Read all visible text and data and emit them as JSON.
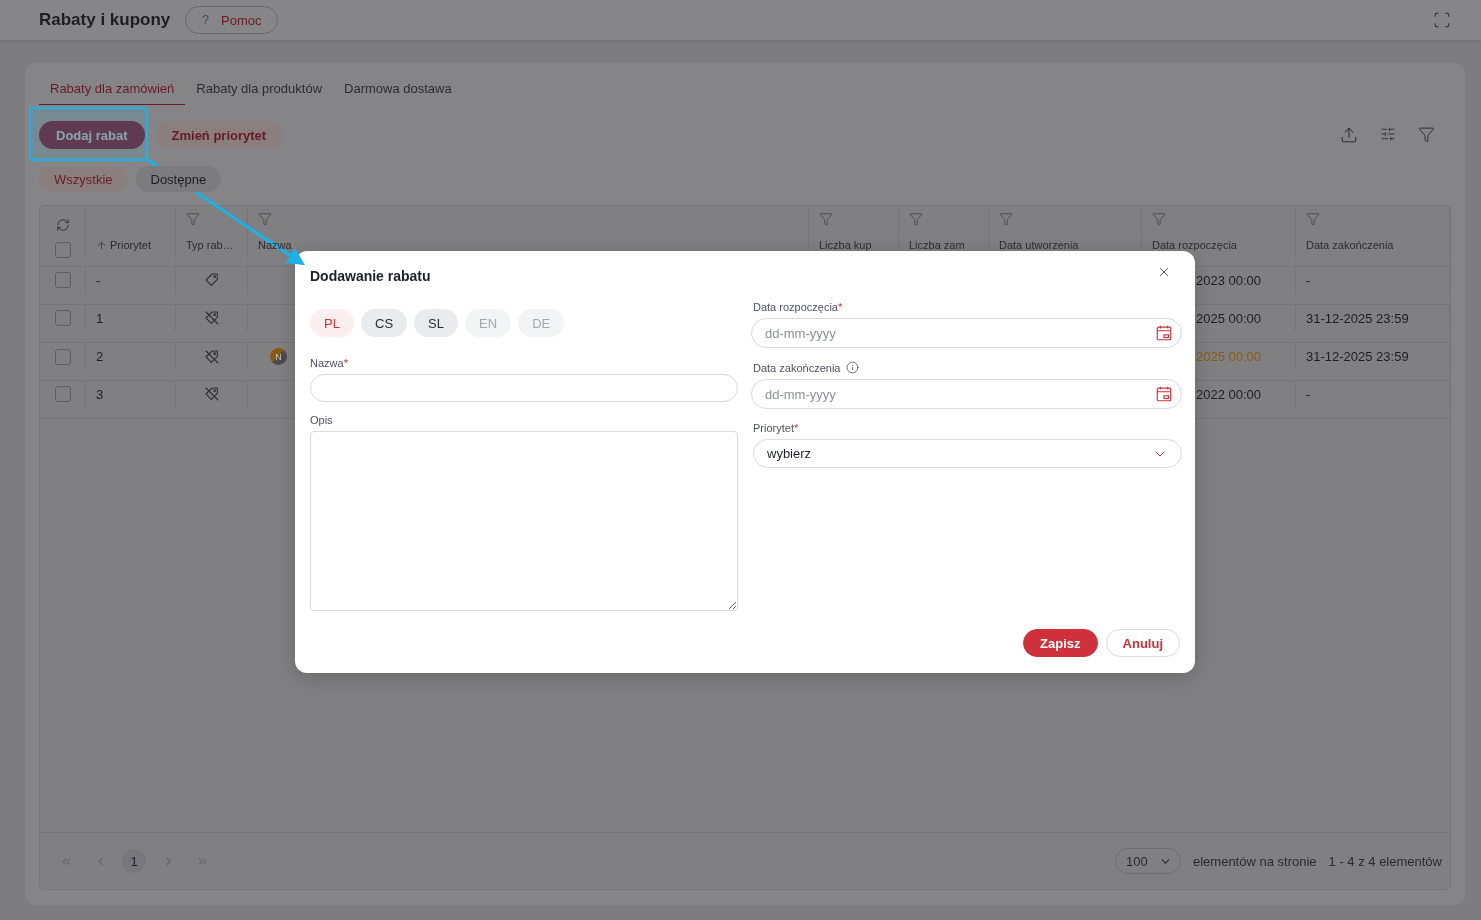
{
  "header": {
    "title": "Rabaty i kupony",
    "help_button": {
      "icon_text": "?",
      "label": "Pomoc"
    }
  },
  "tabs": [
    {
      "label": "Rabaty dla zamówień",
      "selected": true
    },
    {
      "label": "Rabaty dla produktów",
      "selected": false
    },
    {
      "label": "Darmowa dostawa",
      "selected": false
    }
  ],
  "actions": [
    {
      "label": "Dodaj rabat",
      "kind": "primary"
    },
    {
      "label": "Zmień priorytet",
      "kind": "secondary"
    }
  ],
  "filters": [
    {
      "label": "Wszystkie",
      "selected": true
    },
    {
      "label": "Dostępne",
      "selected": false
    }
  ],
  "table": {
    "select_all_checked": false,
    "columns": [
      {
        "label": "Priorytet",
        "kind": "sort"
      },
      {
        "label": "Typ rab…",
        "kind": "filter"
      },
      {
        "label": "Nazwa",
        "kind": "filter"
      },
      {
        "label": "Liczba kup",
        "kind": "filter"
      },
      {
        "label": "Liczba zam",
        "kind": "filter"
      },
      {
        "label": "Data utworzenia",
        "kind": "filter"
      },
      {
        "label": "Data rozpoczęcia",
        "kind": "filter"
      },
      {
        "label": "Data zakończenia",
        "kind": "filter"
      }
    ],
    "rows": [
      {
        "checked": false,
        "priority": "-",
        "kind": "tag",
        "start": "2023 00:00",
        "start_warning": false,
        "end": "-"
      },
      {
        "checked": false,
        "priority": "1",
        "kind": "tag_off",
        "start": "2025 00:00",
        "start_warning": false,
        "end": "31-12-2025 23:59"
      },
      {
        "checked": false,
        "priority": "2",
        "kind": "tag_off",
        "badge": "N",
        "start": "2025 00:00",
        "start_warning": true,
        "end": "31-12-2025 23:59"
      },
      {
        "checked": false,
        "priority": "3",
        "kind": "tag_off",
        "start": "2022 00:00",
        "start_warning": false,
        "end": "-"
      }
    ]
  },
  "pagination": {
    "pages": [
      {
        "label": "1",
        "selected": true
      }
    ],
    "page_size": "100",
    "page_size_label": "elementów na stronie",
    "summary": "1 - 4 z 4 elementów"
  },
  "dialog": {
    "title": "Dodawanie rabatu",
    "languages": [
      {
        "label": "PL",
        "selected": true,
        "disabled": false
      },
      {
        "label": "CS",
        "selected": false,
        "disabled": false
      },
      {
        "label": "SL",
        "selected": false,
        "disabled": false
      },
      {
        "label": "EN",
        "selected": false,
        "disabled": true
      },
      {
        "label": "DE",
        "selected": false,
        "disabled": true
      }
    ],
    "name": {
      "label": "Nazwa",
      "required_mark": "*"
    },
    "description": {
      "label": "Opis"
    },
    "start_date": {
      "label": "Data rozpoczęcia",
      "required_mark": "*",
      "placeholder": "dd-mm-yyyy"
    },
    "end_date": {
      "label": "Data zakończenia",
      "info": true,
      "placeholder": "dd-mm-yyyy"
    },
    "priority": {
      "label": "Priorytet",
      "required_mark": "*",
      "value": "wybierz"
    },
    "buttons": [
      {
        "label": "Zapisz",
        "kind": "primary"
      },
      {
        "label": "Anuluj",
        "kind": "secondary"
      }
    ]
  }
}
